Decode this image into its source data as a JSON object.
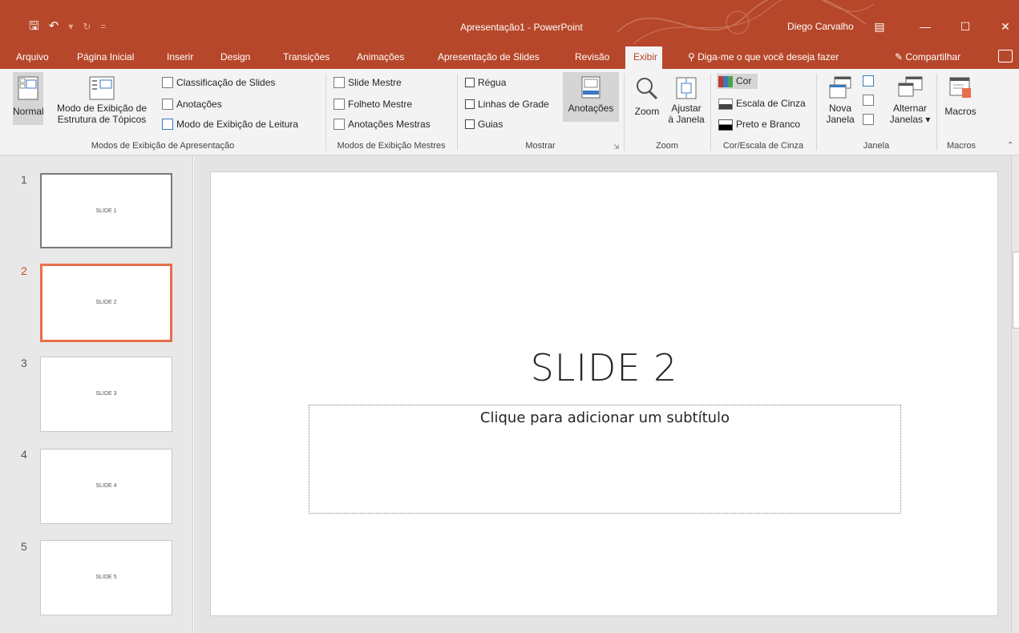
{
  "titlebar": {
    "title": "Apresentação1  -  PowerPoint",
    "user": "Diego Carvalho",
    "qat": {
      "save_icon": "save-icon",
      "undo_icon": "undo-icon",
      "redo_icon": "redo-icon"
    }
  },
  "tabs": [
    "Arquivo",
    "Página Inicial",
    "Inserir",
    "Design",
    "Transições",
    "Animações",
    "Apresentação de Slides",
    "Revisão",
    "Exibir"
  ],
  "tell_me": "Diga-me o que você deseja fazer",
  "share": "Compartilhar",
  "ribbon": {
    "views": {
      "normal": "Normal",
      "outline_1": "Modo de Exibição de",
      "outline_2": "Estrutura de Tópicos",
      "sorter": "Classificação de Slides",
      "notes_page": "Anotações",
      "reading": "Modo de Exibição de Leitura",
      "label": "Modos de Exibição de Apresentação"
    },
    "masters": {
      "slide_master": "Slide Mestre",
      "handout_master": "Folheto Mestre",
      "notes_master": "Anotações Mestras",
      "label": "Modos de Exibição Mestres"
    },
    "show": {
      "ruler": "Régua",
      "gridlines": "Linhas de Grade",
      "guides": "Guias",
      "label": "Mostrar"
    },
    "notes": {
      "label": "Anotações"
    },
    "zoom": {
      "zoom": "Zoom",
      "fit_1": "Ajustar",
      "fit_2": "à Janela",
      "label": "Zoom"
    },
    "color": {
      "color": "Cor",
      "grayscale": "Escala de Cinza",
      "bw": "Preto e Branco",
      "label": "Cor/Escala de Cinza"
    },
    "window": {
      "new_1": "Nova",
      "new_2": "Janela",
      "switch_1": "Alternar",
      "switch_2": "Janelas ▾",
      "label": "Janela"
    },
    "macros": {
      "macros": "Macros",
      "label": "Macros"
    }
  },
  "thumbnails": [
    {
      "num": "1",
      "text": "SLIDE 1"
    },
    {
      "num": "2",
      "text": "SLIDE 2"
    },
    {
      "num": "3",
      "text": "SLIDE 3"
    },
    {
      "num": "4",
      "text": "SLIDE 4"
    },
    {
      "num": "5",
      "text": "SLIDE 5"
    }
  ],
  "slide": {
    "title": "SLIDE 2",
    "subtitle_placeholder": "Clique para adicionar um subtítulo"
  },
  "colors": {
    "accent": "#b7472a",
    "selection": "#e86f4c"
  }
}
